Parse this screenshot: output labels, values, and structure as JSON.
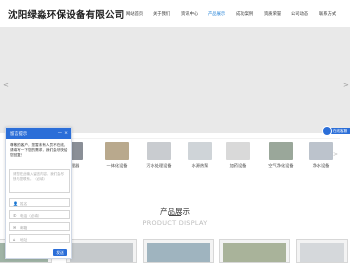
{
  "header": {
    "company_name": "沈阳绿淼环保设备有限公司",
    "nav": [
      {
        "label": "网站首页",
        "active": false
      },
      {
        "label": "关于我们",
        "active": false
      },
      {
        "label": "资讯中心",
        "active": false
      },
      {
        "label": "产品展示",
        "active": true
      },
      {
        "label": "成功案例",
        "active": false
      },
      {
        "label": "资质荣誉",
        "active": false
      },
      {
        "label": "公司动态",
        "active": false
      },
      {
        "label": "联系方式",
        "active": false
      }
    ]
  },
  "banner": {
    "left_arrow": "<",
    "right_arrow": ">"
  },
  "categories": [
    {
      "label": "水处理器",
      "color": "#8a8f97"
    },
    {
      "label": "一体化设备",
      "color": "#b9a98d"
    },
    {
      "label": "污水处理设备",
      "color": "#c9ccd0"
    },
    {
      "label": "水源热泵",
      "color": "#cfd4d8"
    },
    {
      "label": "加药设备",
      "color": "#d9d9d9"
    },
    {
      "label": "空气净化设备",
      "color": "#9aa79a"
    },
    {
      "label": "净水设备",
      "color": "#bcc3cc"
    }
  ],
  "products": {
    "title": "产品展示",
    "subtitle": "PRODUCT DISPLAY",
    "cards": [
      {
        "color": "#9fb3a5"
      },
      {
        "color": "#c5c9cc"
      },
      {
        "color": "#9fb4bf"
      },
      {
        "color": "#a9b39a"
      },
      {
        "color": "#d5d8db"
      }
    ]
  },
  "chat": {
    "title": "留言提示",
    "minimize": "—",
    "close": "×",
    "message": "尊敬的客户，您暂未有人员不在线，请填写一下您的需求，我们会尽快给您回复！",
    "textarea_placeholder": "请您在此输入留言内容，我们会尽快与您联系。（必填）",
    "fields": [
      {
        "icon": "👤",
        "placeholder": "姓名"
      },
      {
        "icon": "✆",
        "placeholder": "电话（必填）"
      },
      {
        "icon": "✉",
        "placeholder": "邮箱"
      },
      {
        "icon": "⌂",
        "placeholder": "地址"
      }
    ],
    "send": "发送"
  },
  "service": {
    "label": "在线客服"
  }
}
